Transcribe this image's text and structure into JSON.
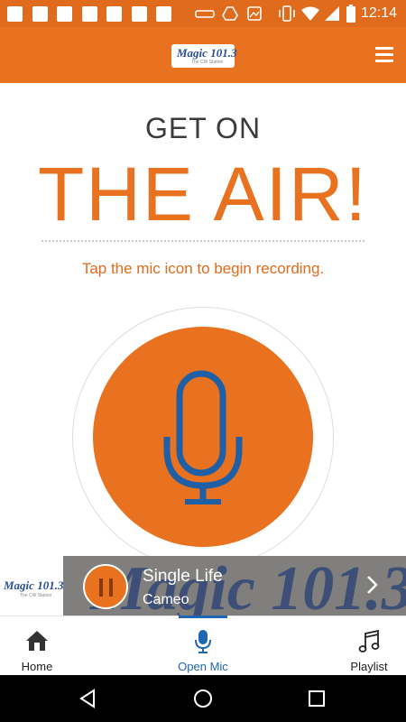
{
  "status_bar": {
    "time": "12:14",
    "icons": [
      "notification-icon",
      "notification-icon",
      "notification-icon",
      "notification-icon",
      "notification-icon",
      "notification-icon",
      "notification-icon",
      "drive-icon",
      "image-icon",
      "vibrate-icon",
      "wifi-icon",
      "signal-icon",
      "battery-icon"
    ]
  },
  "header": {
    "logo_text": "Magic 101.3",
    "logo_sub": "The CW Station",
    "menu_icon": "hamburger-menu-icon"
  },
  "main": {
    "heading_small": "GET ON",
    "heading_large": "THE AIR!",
    "instruction": "Tap the mic icon to begin recording.",
    "mic_icon": "microphone-icon"
  },
  "now_playing": {
    "title": "Single Life",
    "artist": "Cameo",
    "station_logo_text": "Magic 101.3",
    "station_logo_sub": "The CW Station",
    "background_text": "Magic 101.3"
  },
  "bottom_nav": {
    "items": [
      {
        "label": "Home",
        "icon": "home-icon"
      },
      {
        "label": "Open Mic",
        "icon": "microphone-icon",
        "active": true
      },
      {
        "label": "Playlist",
        "icon": "music-note-icon"
      }
    ]
  },
  "colors": {
    "brand_orange": "#e8721f",
    "accent_blue": "#1f67b3",
    "text_dark": "#3b3b3b"
  }
}
